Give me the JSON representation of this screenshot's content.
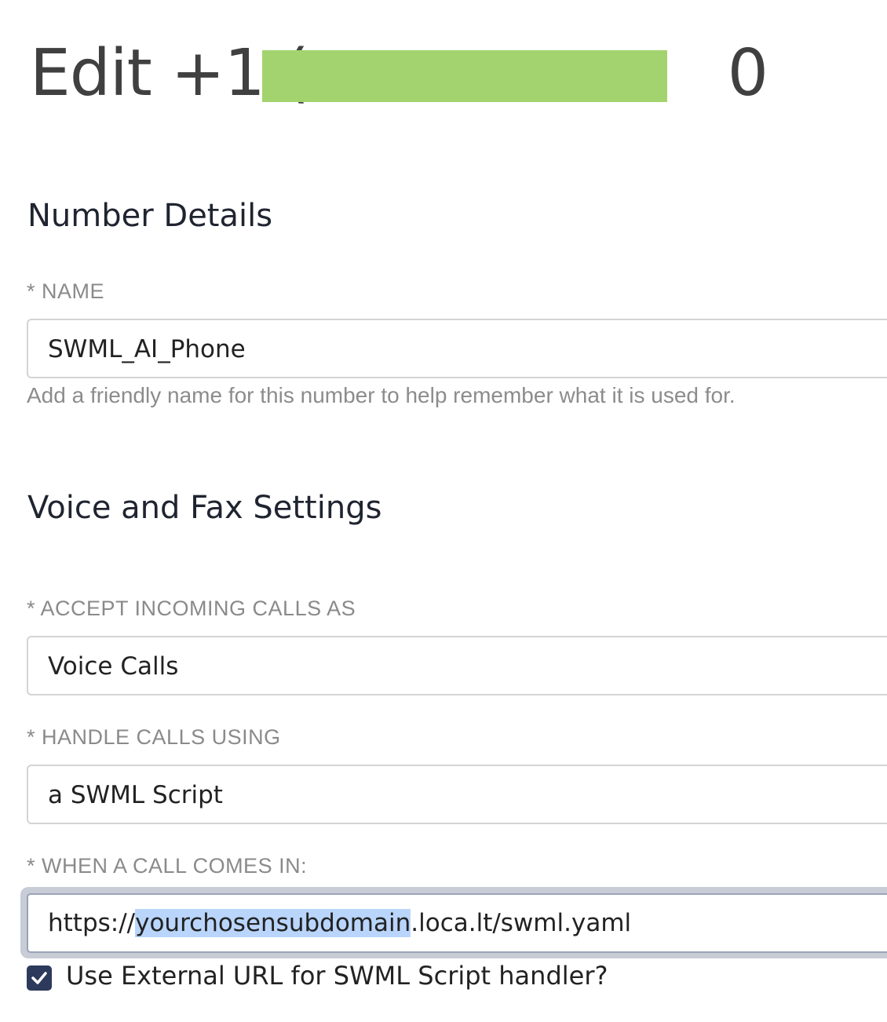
{
  "header": {
    "title_prefix": "Edit +1 (",
    "title_suffix": "0",
    "redaction_color": "#a3d36e"
  },
  "number_details": {
    "heading": "Number Details",
    "name_label": "* NAME",
    "name_value": "SWML_AI_Phone",
    "name_help": "Add a friendly name for this number to help remember what it is used for."
  },
  "voice_fax": {
    "heading": "Voice and Fax Settings",
    "accept_label": "* ACCEPT INCOMING CALLS AS",
    "accept_value": "Voice Calls",
    "handle_label": "* HANDLE CALLS USING",
    "handle_value": "a SWML Script",
    "when_label": "* WHEN A CALL COMES IN:",
    "url_prefix": "https://",
    "url_selected": "yourchosensubdomain",
    "url_suffix": ".loca.lt/swml.yaml",
    "external_url_label": "Use External URL for SWML Script handler?",
    "external_url_checked": true
  },
  "colors": {
    "checkbox_fill": "#2d3a5c",
    "selection_highlight": "#b9d5fb",
    "focus_ring": "#c7ccd6"
  },
  "icons": {
    "checkbox": "checkmark-icon"
  }
}
